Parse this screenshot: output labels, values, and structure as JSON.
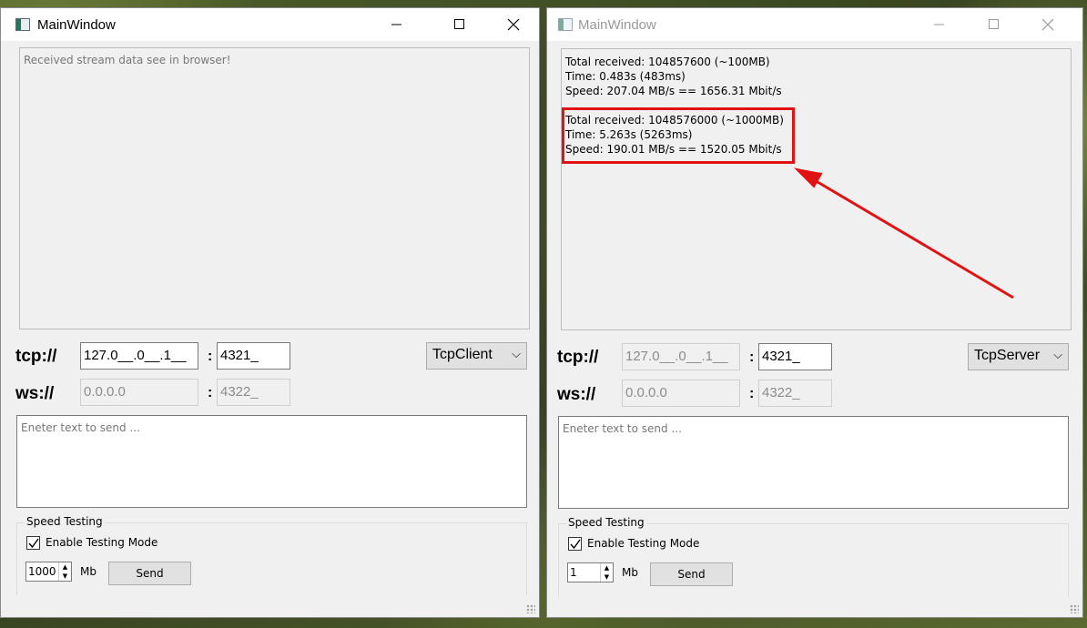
{
  "client": {
    "title": "MainWindow",
    "output_placeholder": "Received stream data see in browser!",
    "tcp_label": "tcp://",
    "tcp_ip": "127.0__.0__.1__",
    "tcp_port": "4321_",
    "ws_label": "ws://",
    "ws_ip": "0.0.0.0",
    "ws_port": "4322_",
    "colon": ":",
    "mode": "TcpClient",
    "send_placeholder": "Eneter text to send ...",
    "group_title": "Speed  Testing",
    "enable_label": "Enable Testing Mode",
    "enable_checked": true,
    "size_value": "1000",
    "unit": "Mb",
    "send_label": "Send"
  },
  "server": {
    "title": "MainWindow",
    "results": [
      {
        "line1": "Total received: 104857600 (~100MB)",
        "line2": "Time: 0.483s (483ms)",
        "line3": "Speed: 207.04 MB/s  ==  1656.31 Mbit/s"
      },
      {
        "line1": "Total received: 1048576000 (~1000MB)",
        "line2": "Time: 5.263s (5263ms)",
        "line3": "Speed: 190.01 MB/s  ==  1520.05 Mbit/s"
      }
    ],
    "tcp_label": "tcp://",
    "tcp_ip": "127.0__.0__.1__",
    "tcp_port": "4321_",
    "ws_label": "ws://",
    "ws_ip": "0.0.0.0",
    "ws_port": "4322_",
    "colon": ":",
    "mode": "TcpServer",
    "send_placeholder": "Eneter text to send ...",
    "group_title": "Speed  Testing",
    "enable_label": "Enable Testing Mode",
    "enable_checked": true,
    "size_value": "1",
    "unit": "Mb",
    "send_label": "Send"
  },
  "annotation_color": "#e21212"
}
